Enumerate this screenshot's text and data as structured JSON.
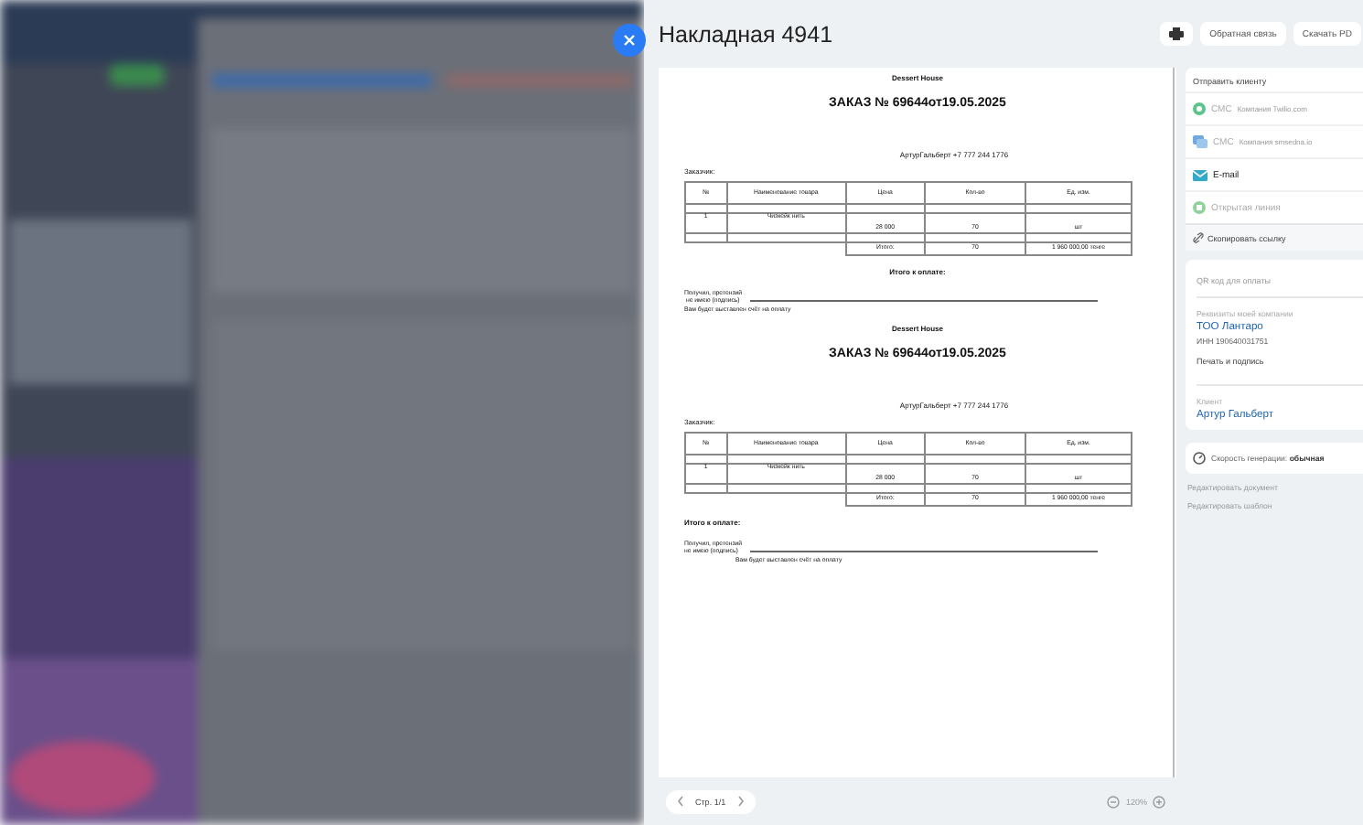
{
  "panel": {
    "title": "Накладная 4941",
    "actions": [
      {
        "kind": "print"
      },
      {
        "kind": "text",
        "label": "Обратная связь"
      },
      {
        "kind": "text",
        "label": "Скачать PD"
      }
    ]
  },
  "document": {
    "copies": [
      {
        "company": "Dessert House",
        "title": "ЗАКАЗ № 69644от19.05.2025",
        "contact": "АртурГальберт  +7 777 244 1776",
        "customer_label": "Заказчик:",
        "columns": [
          "№",
          "Наименование товара",
          "Цена",
          "Кол-во",
          "Ед. изм."
        ],
        "rows": [
          [
            "",
            "",
            "",
            "",
            ""
          ],
          [
            "1",
            "Чизкейк нить",
            "28 000",
            "70",
            "шт"
          ],
          [
            "",
            "",
            "",
            "",
            ""
          ]
        ],
        "totals": {
          "label": "Итого:",
          "qty": "70",
          "sum": "1 960 000,00 тенге"
        },
        "payment_label": "Итого к оплате:",
        "payment_left": false,
        "received": "Получил, претензий\n не имею (подпись)",
        "invoice_note": "Вам будет выставлен счёт на оплату",
        "note_indented": false
      },
      {
        "company": "Dessert House",
        "title": "ЗАКАЗ № 69644от19.05.2025",
        "contact": "АртурГальберт  +7 777 244 1776",
        "customer_label": "Заказчик:",
        "columns": [
          "№",
          "Наименование товара",
          "Цена",
          "Кол-во",
          "Ед. изм."
        ],
        "rows": [
          [
            "",
            "",
            "",
            "",
            ""
          ],
          [
            "1",
            "Чизкейк нить",
            "28 000",
            "70",
            "шт"
          ],
          [
            "",
            "",
            "",
            "",
            ""
          ]
        ],
        "totals": {
          "label": "Итого:",
          "qty": "70",
          "sum": "1 960 000,00 тенге"
        },
        "payment_label": "Итого к оплате:",
        "payment_left": true,
        "received": "Получил, претензий\nне имею (подпись)",
        "invoice_note": "Вам будет выставлен счёт на оплату",
        "note_indented": true
      }
    ]
  },
  "pager": {
    "label": "Стр. 1/1"
  },
  "zoom": {
    "label": "120%"
  },
  "sidebar": {
    "send": {
      "title": "Отправить клиенту",
      "items": [
        {
          "kind": "chat",
          "label": "СМС",
          "note": "Компания Twilio.com",
          "disabled": true
        },
        {
          "kind": "message",
          "label": "СМС",
          "note": "Компания smsedna.io",
          "disabled": true
        },
        {
          "kind": "mail",
          "label": "E-mail",
          "disabled": false
        },
        {
          "kind": "line",
          "label": "Открытая линия",
          "disabled": true
        }
      ],
      "copy_link": "Скопировать ссылку"
    },
    "qr": {
      "title": "QR код для оплаты"
    },
    "company": {
      "caption": "Реквизиты моей компании",
      "name": "ТОО Лантаро",
      "inn": "ИНН 190640031751",
      "stamp": "Печать и подпись"
    },
    "client": {
      "caption": "Клиент",
      "name": "Артур Гальберт"
    },
    "speed": {
      "label": "Скорость генерации:",
      "value": "обычная"
    },
    "links": [
      "Редактировать документ",
      "Редактировать шаблон"
    ]
  }
}
